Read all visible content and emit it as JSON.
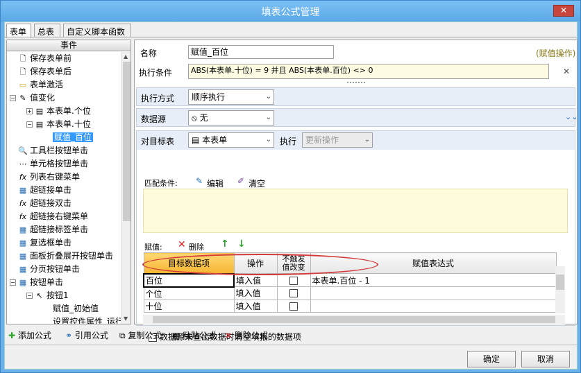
{
  "window": {
    "title": "填表公式管理",
    "close_symbol": "✕"
  },
  "tabs": [
    "表单",
    "总表",
    "自定义脚本函数"
  ],
  "left": {
    "header": "事件",
    "tree": [
      {
        "label": "保存表单前",
        "icon": "save-doc-icon"
      },
      {
        "label": "保存表单后",
        "icon": "save-doc-icon"
      },
      {
        "label": "表单激活",
        "icon": "folder-icon"
      },
      {
        "label": "值变化",
        "icon": "value-change-icon",
        "expander": "−"
      },
      {
        "label": "本表单.个位",
        "icon": "form-icon",
        "expander": "+"
      },
      {
        "label": "本表单.十位",
        "icon": "form-icon",
        "expander": "−"
      },
      {
        "label": "赋值_百位",
        "selected": true
      },
      {
        "label": "工具栏按钮单击",
        "icon": "search-tool-icon"
      },
      {
        "label": "单元格按钮单击",
        "icon": "dots-icon"
      },
      {
        "label": "列表右键菜单",
        "icon": "fx-icon"
      },
      {
        "label": "超链接单击",
        "icon": "grid-icon"
      },
      {
        "label": "超链接双击",
        "icon": "fx-icon"
      },
      {
        "label": "超链接右键菜单",
        "icon": "fx-icon"
      },
      {
        "label": "超链接标签单击",
        "icon": "grid-icon"
      },
      {
        "label": "复选框单击",
        "icon": "grid-icon"
      },
      {
        "label": "面板折叠展开按钮单击",
        "icon": "grid-icon"
      },
      {
        "label": "分页按钮单击",
        "icon": "grid-icon"
      },
      {
        "label": "按钮单击",
        "icon": "grid-icon",
        "expander": "−"
      },
      {
        "label": "按钮1",
        "icon": "cursor-icon",
        "expander": "−"
      },
      {
        "label": "赋值_初始值"
      },
      {
        "label": "设置控件属性_运行"
      }
    ]
  },
  "form": {
    "name_label": "名称",
    "name_value": "赋值_百位",
    "tag": "(赋值操作)",
    "cond_label": "执行条件",
    "cond_value": "ABS(本表单.十位) = 9 并且  ABS(本表单.百位) <> 0",
    "mode_label": "执行方式",
    "mode_value": "顺序执行",
    "ds_label": "数据源",
    "ds_value": "无",
    "target_label": "对目标表",
    "target_value": "本表单",
    "exec_label": "执行",
    "exec_value": "更新操作",
    "match_label": "匹配条件:",
    "edit_label": "编辑",
    "clear_label": "清空",
    "assign_label": "赋值:",
    "delete_label": "删除",
    "grid_headers": [
      "目标数据项",
      "操作",
      "不触发值改变",
      "赋值表达式"
    ],
    "grid_rows": [
      {
        "target": "百位",
        "op": "填入值",
        "expr": "本表单.百位 - 1"
      },
      {
        "target": "个位",
        "op": "填入值",
        "expr": ""
      },
      {
        "target": "十位",
        "op": "填入值",
        "expr": ""
      }
    ],
    "clear_check_label": "数据源未查出数据时清空填报的数据项"
  },
  "toolbar": [
    "添加公式",
    "引用公式",
    "复制公式",
    "粘贴公式",
    "删除公式"
  ],
  "buttons": {
    "ok": "确定",
    "cancel": "取消"
  },
  "colors": {
    "title_bg": "#5aa8e6",
    "selection": "#3399ff",
    "active_header": "#f5b532",
    "highlight_ellipse": "#d43a3a"
  }
}
